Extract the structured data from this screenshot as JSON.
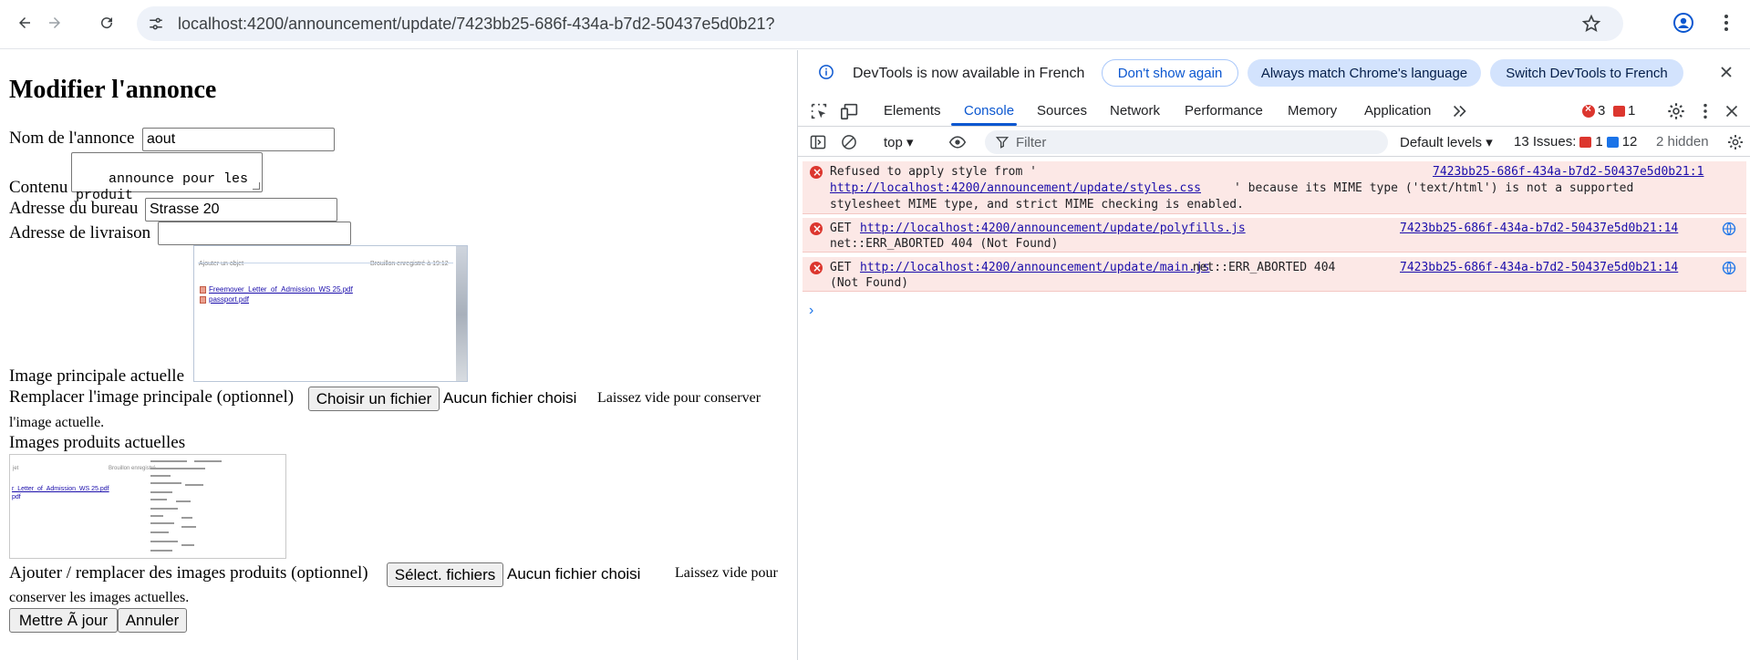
{
  "browser": {
    "url": "localhost:4200/announcement/update/7423bb25-686f-434a-b7d2-50437e5d0b21?"
  },
  "page": {
    "title": "Modifier l'annonce",
    "fields": {
      "name_label": "Nom de l'annonce",
      "name_value": "aout",
      "content_label": "Contenu",
      "content_value": "announce pour les\nproduit",
      "office_label": "Adresse du bureau",
      "office_value": "Strasse 20",
      "delivery_label": "Adresse de livraison",
      "delivery_value": ""
    },
    "main_image": {
      "label": "Image principale actuelle",
      "thumb_header_left": "Ajouter un objet",
      "thumb_header_right": "Brouillon enregistré à 19:12",
      "thumb_files": [
        "Freemover_Letter_of_Admission_WS 25.pdf",
        "passport.pdf"
      ]
    },
    "replace_main": {
      "label": "Remplacer l'image principale (optionnel)",
      "button": "Choisir un fichier",
      "status": "Aucun fichier choisi",
      "hint_line1": "Laissez vide pour conserver",
      "hint_line2": "l'image actuelle."
    },
    "product_images": {
      "label": "Images produits actuelles",
      "thumb_header_left": "jet",
      "thumb_header_right": "Brouillon enregistré",
      "thumb_link1": "r_Letter_of_Admission_WS 25.pdf",
      "thumb_link2": "pdf"
    },
    "add_products": {
      "label": "Ajouter / remplacer des images produits (optionnel)",
      "button": "Sélect. fichiers",
      "status": "Aucun fichier choisi",
      "hint_line1": "Laissez vide pour",
      "hint_line2": "conserver les images actuelles."
    },
    "actions": {
      "submit": "Mettre Ã  jour",
      "cancel": "Annuler"
    }
  },
  "devtools": {
    "infobar": {
      "message": "DevTools is now available in French",
      "dont_show": "Don't show again",
      "always_match": "Always match Chrome's language",
      "switch": "Switch DevTools to French"
    },
    "tabs": [
      "Elements",
      "Console",
      "Sources",
      "Network",
      "Performance",
      "Memory",
      "Application"
    ],
    "active_tab": "Console",
    "error_count": "3",
    "warning_count": "1",
    "context": "top",
    "filter_placeholder": "Filter",
    "levels": "Default levels",
    "issues_label": "13 Issues:",
    "issues_errors": "1",
    "issues_info": "12",
    "hidden": "2 hidden",
    "messages": [
      {
        "line1_pre": "Refused to apply style from '",
        "link": "http://localhost:4200/announcement/update/styles.css",
        "line2_post": "' because its MIME type ('text/html') is not a supported",
        "line3": "stylesheet MIME type, and strict MIME checking is enabled.",
        "source": "7423bb25-686f-434a-b7d2-50437e5d0b21:1"
      },
      {
        "method": "GET",
        "link": "http://localhost:4200/announcement/update/polyfills.js",
        "line2": "net::ERR_ABORTED 404 (Not Found)",
        "source": "7423bb25-686f-434a-b7d2-50437e5d0b21:14"
      },
      {
        "method": "GET",
        "link": "http://localhost:4200/announcement/update/main.js",
        "inline": " net::ERR_ABORTED 404",
        "line2": "(Not Found)",
        "source": "7423bb25-686f-434a-b7d2-50437e5d0b21:14"
      }
    ],
    "prompt": "›"
  },
  "colors": {
    "accent": "#0b57d0",
    "error": "#dc362e",
    "error_bg": "#fce8e6",
    "link": "#1a0dab"
  }
}
